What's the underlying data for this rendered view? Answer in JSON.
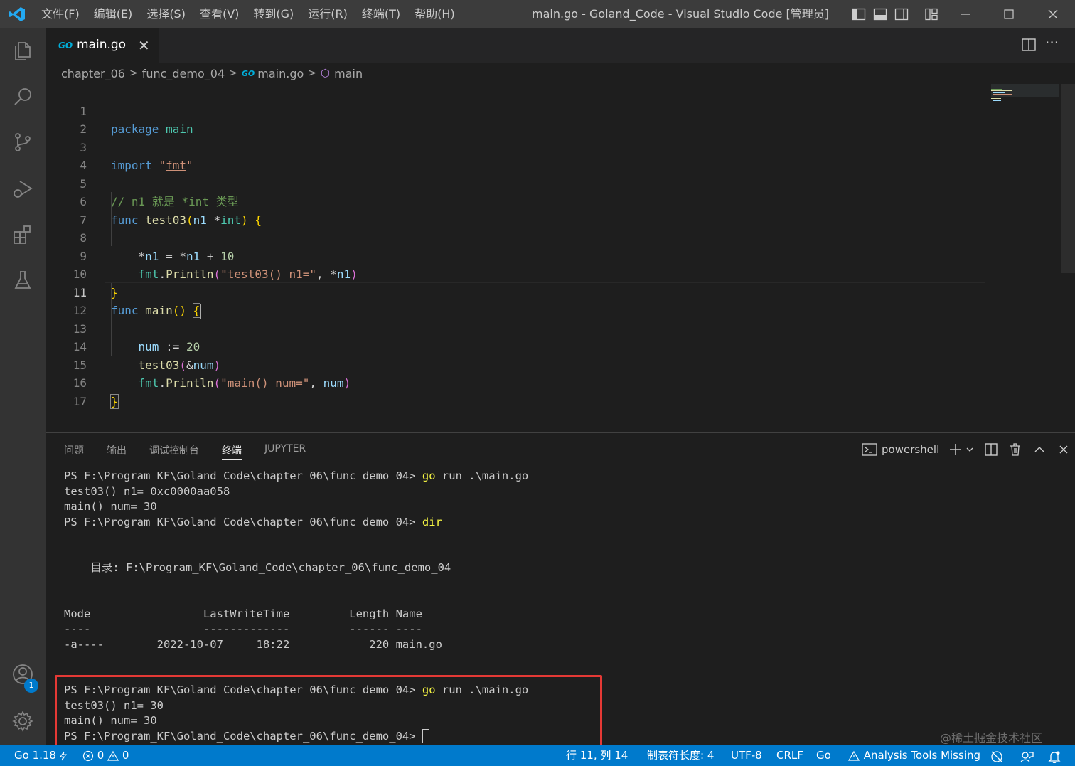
{
  "window": {
    "title": "main.go - Goland_Code - Visual Studio Code [管理员]",
    "menu": [
      "文件(F)",
      "编辑(E)",
      "选择(S)",
      "查看(V)",
      "转到(G)",
      "运行(R)",
      "终端(T)",
      "帮助(H)"
    ]
  },
  "activity_bar": {
    "items": [
      "explorer-icon",
      "search-icon",
      "source-control-icon",
      "run-debug-icon",
      "extensions-icon",
      "testing-icon"
    ],
    "account_badge": "1"
  },
  "tab": {
    "go_icon": "GO",
    "label": "main.go",
    "close": "✕"
  },
  "editor_actions": {
    "more": "···"
  },
  "breadcrumb": {
    "folder1": "chapter_06",
    "folder2": "func_demo_04",
    "file": "main.go",
    "symbol": "main"
  },
  "editor": {
    "active_line": 11,
    "line_numbers": [
      "1",
      "2",
      "3",
      "4",
      "5",
      "6",
      "7",
      "8",
      "9",
      "10",
      "11",
      "12",
      "13",
      "14",
      "15",
      "16",
      "17"
    ]
  },
  "panel": {
    "tabs": [
      "问题",
      "输出",
      "调试控制台",
      "终端",
      "JUPYTER"
    ],
    "active_tab": "终端",
    "terminal_name": "powershell",
    "terminal_lines": [
      {
        "prompt": "PS F:\\Program_KF\\Goland_Code\\chapter_06\\func_demo_04> ",
        "cmd": "go",
        "rest": " run .\\main.go"
      },
      {
        "text": "test03() n1= 0xc0000aa058"
      },
      {
        "text": "main() num= 30"
      },
      {
        "prompt": "PS F:\\Program_KF\\Goland_Code\\chapter_06\\func_demo_04> ",
        "cmd": "dir",
        "rest": ""
      },
      {
        "text": ""
      },
      {
        "text": ""
      },
      {
        "text": "    目录: F:\\Program_KF\\Goland_Code\\chapter_06\\func_demo_04"
      },
      {
        "text": ""
      },
      {
        "text": ""
      },
      {
        "text": "Mode                 LastWriteTime         Length Name"
      },
      {
        "text": "----                 -------------         ------ ----"
      },
      {
        "text": "-a----        2022-10-07     18:22            220 main.go"
      },
      {
        "text": ""
      },
      {
        "text": ""
      },
      {
        "prompt": "PS F:\\Program_KF\\Goland_Code\\chapter_06\\func_demo_04> ",
        "cmd": "go",
        "rest": " run .\\main.go"
      },
      {
        "text": "test03() n1= 30"
      },
      {
        "text": "main() num= 30"
      },
      {
        "prompt": "PS F:\\Program_KF\\Goland_Code\\chapter_06\\func_demo_04> ",
        "cmd": "",
        "rest": "",
        "cursor": true
      }
    ]
  },
  "statusbar": {
    "go_version": "Go 1.18",
    "errors": "0",
    "warnings": "0",
    "position": "行 11, 列 14",
    "tab_size": "制表符长度: 4",
    "encoding": "UTF-8",
    "eol": "CRLF",
    "language": "Go",
    "analysis": "Analysis Tools Missing"
  },
  "watermark": "@稀土掘金技术社区",
  "colors": {
    "accent": "#007acc",
    "highlight_box": "#e53935",
    "keyword": "#569cd6",
    "string": "#ce9178",
    "comment": "#6a9955",
    "function": "#dcdcaa"
  }
}
